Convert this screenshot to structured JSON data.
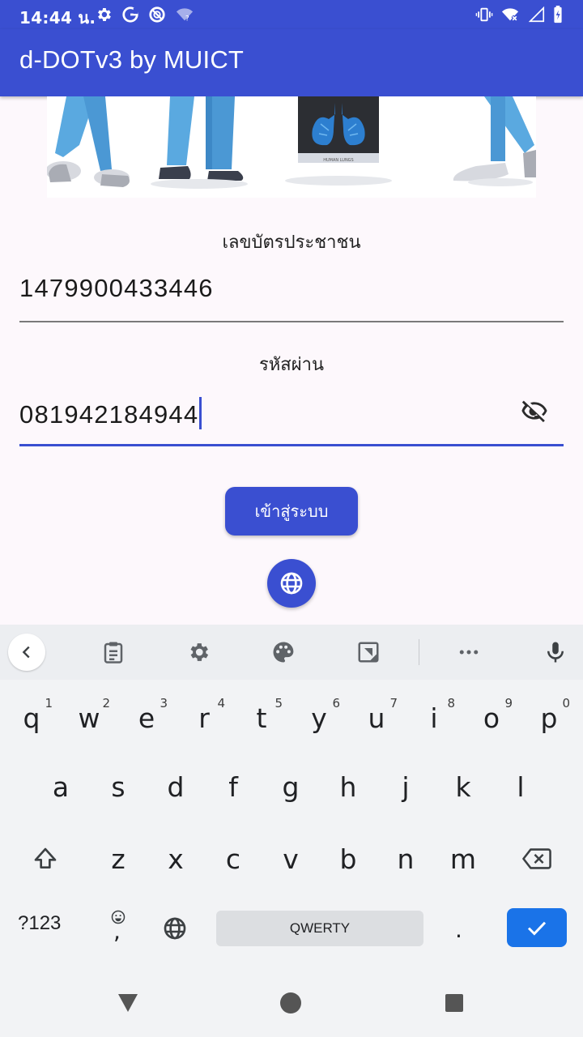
{
  "status_bar": {
    "time": "14:44 น.",
    "icons": [
      "settings-icon",
      "google-icon",
      "no-disturb-icon",
      "wifi-unknown-icon",
      "vibrate-icon",
      "wifi-off-icon",
      "signal-icon",
      "battery-icon"
    ]
  },
  "app_bar": {
    "title": "d-DOTv3 by MUICT"
  },
  "hero": {
    "lungs_caption": "HUMAN LUNGS"
  },
  "form": {
    "id_label": "เลขบัตรประชาชน",
    "id_value": "1479900433446",
    "password_label": "รหัสผ่าน",
    "password_value": "081942184944",
    "login_label": "เข้าสู่ระบบ"
  },
  "colors": {
    "primary": "#3a4fd1",
    "enter_key": "#1a73e8",
    "background": "#fdf8fc"
  },
  "keyboard": {
    "toolbar_icons": [
      "back-icon",
      "clipboard-icon",
      "settings-icon",
      "palette-icon",
      "floating-keyboard-icon",
      "more-icon",
      "mic-icon"
    ],
    "row1": [
      {
        "k": "q",
        "h": "1"
      },
      {
        "k": "w",
        "h": "2"
      },
      {
        "k": "e",
        "h": "3"
      },
      {
        "k": "r",
        "h": "4"
      },
      {
        "k": "t",
        "h": "5"
      },
      {
        "k": "y",
        "h": "6"
      },
      {
        "k": "u",
        "h": "7"
      },
      {
        "k": "i",
        "h": "8"
      },
      {
        "k": "o",
        "h": "9"
      },
      {
        "k": "p",
        "h": "0"
      }
    ],
    "row2": [
      "a",
      "s",
      "d",
      "f",
      "g",
      "h",
      "j",
      "k",
      "l"
    ],
    "row3": [
      "z",
      "x",
      "c",
      "v",
      "b",
      "n",
      "m"
    ],
    "symbols_label": "?123",
    "comma_label": ",",
    "space_label": "QWERTY",
    "period_label": "."
  },
  "nav_bar": {
    "icons": [
      "back-triangle-icon",
      "home-circle-icon",
      "recents-square-icon"
    ]
  }
}
